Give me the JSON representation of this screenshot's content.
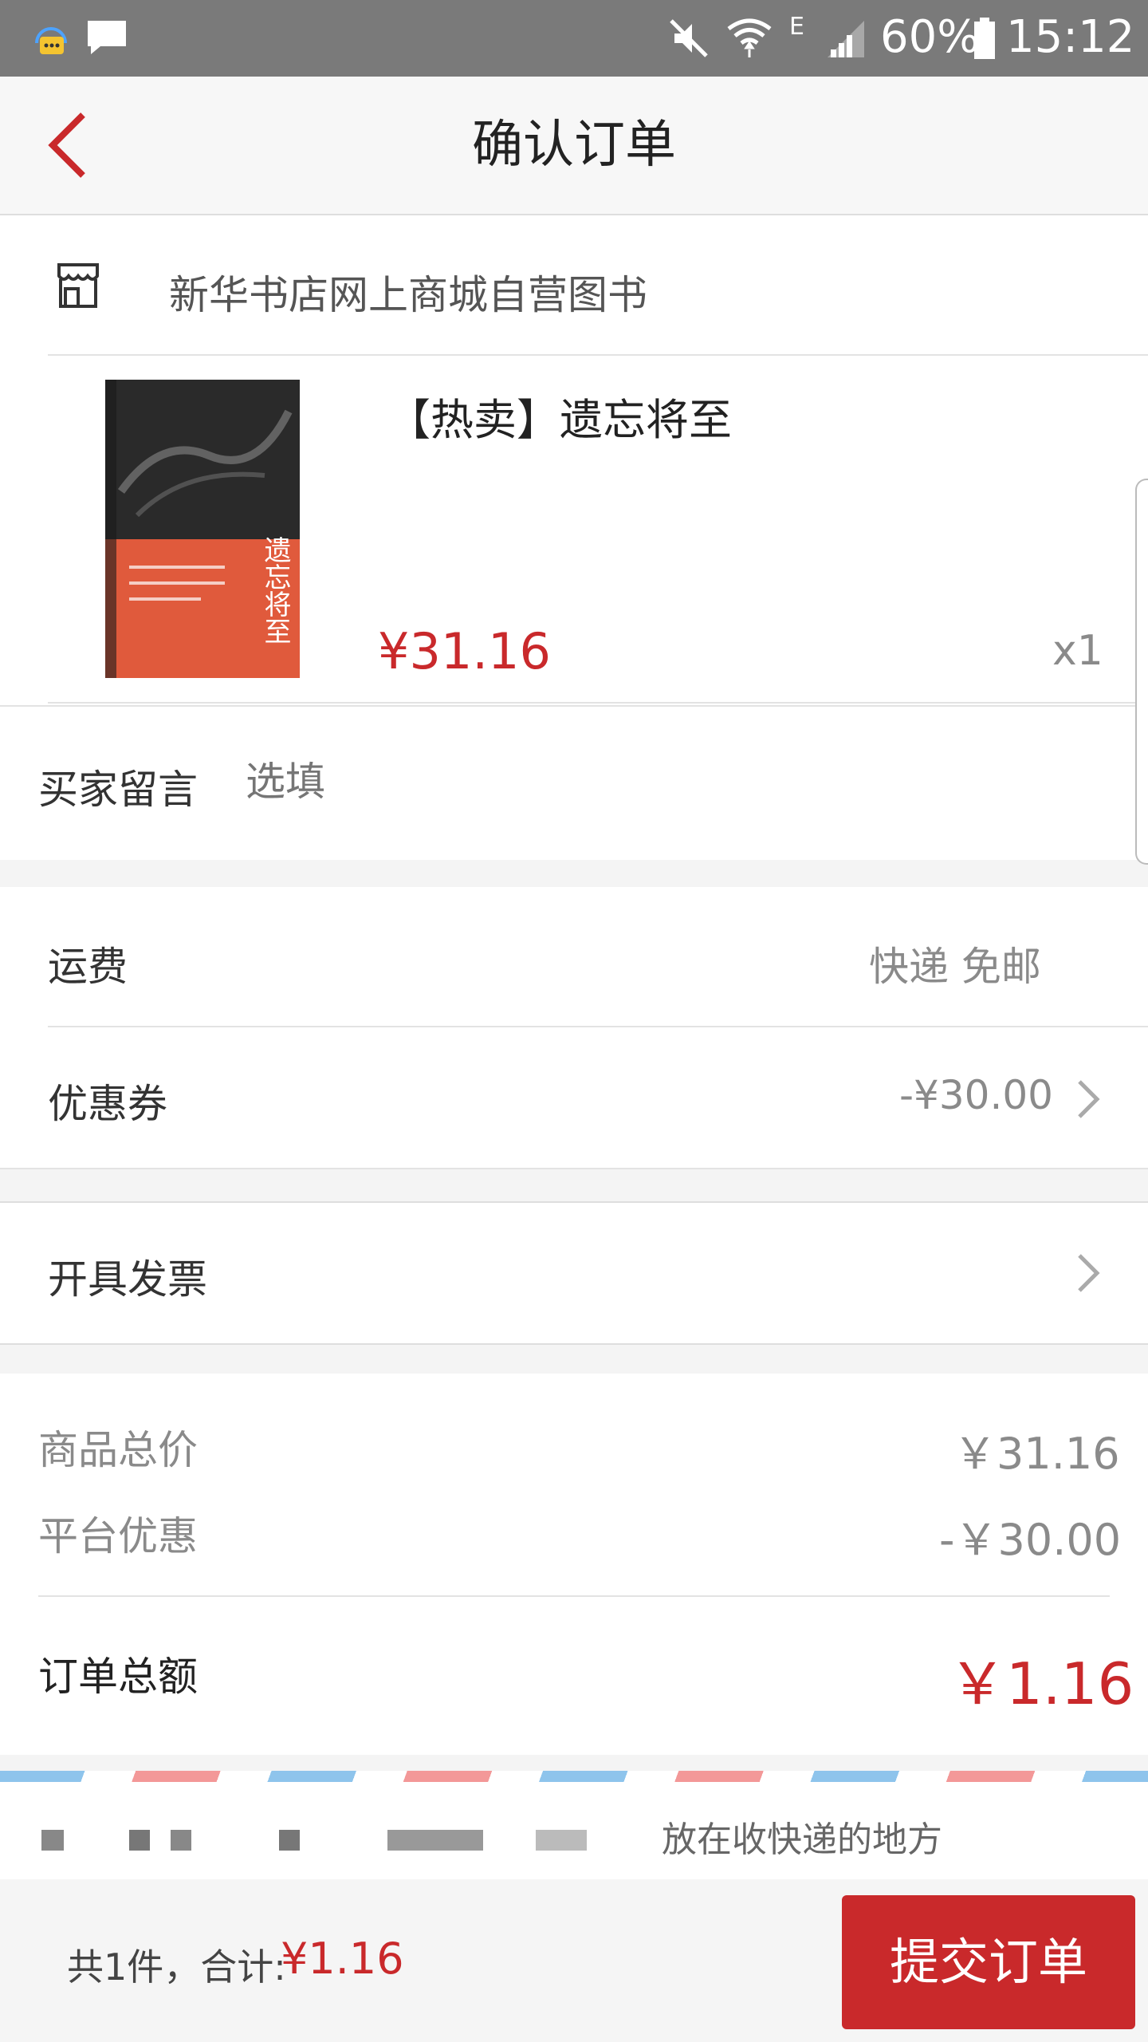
{
  "status_bar": {
    "battery": "60%",
    "time": "15:12",
    "network": "E"
  },
  "nav": {
    "title": "确认订单"
  },
  "store": {
    "name": "新华书店网上商城自营图书"
  },
  "product": {
    "title": "【热卖】遗忘将至",
    "price": "¥31.16",
    "quantity": "x1",
    "cover_title": "遗忘将至"
  },
  "buyer_message": {
    "label": "买家留言",
    "placeholder": "选填"
  },
  "shipping": {
    "label": "运费",
    "value": "快递 免邮"
  },
  "coupon": {
    "label": "优惠券",
    "value": "-¥30.00"
  },
  "invoice": {
    "label": "开具发票"
  },
  "summary": {
    "goods_total_label": "商品总价",
    "goods_total": "￥31.16",
    "platform_discount_label": "平台优惠",
    "platform_discount": "-￥30.00",
    "order_total_label": "订单总额",
    "order_total": "￥1.16"
  },
  "address_hint": "放在收快递的地方",
  "footer": {
    "count_text": "共1件，合计:",
    "total": "¥1.16",
    "submit_label": "提交订单"
  },
  "colors": {
    "accent": "#c9292b",
    "status_bar": "#7a7a7a"
  }
}
